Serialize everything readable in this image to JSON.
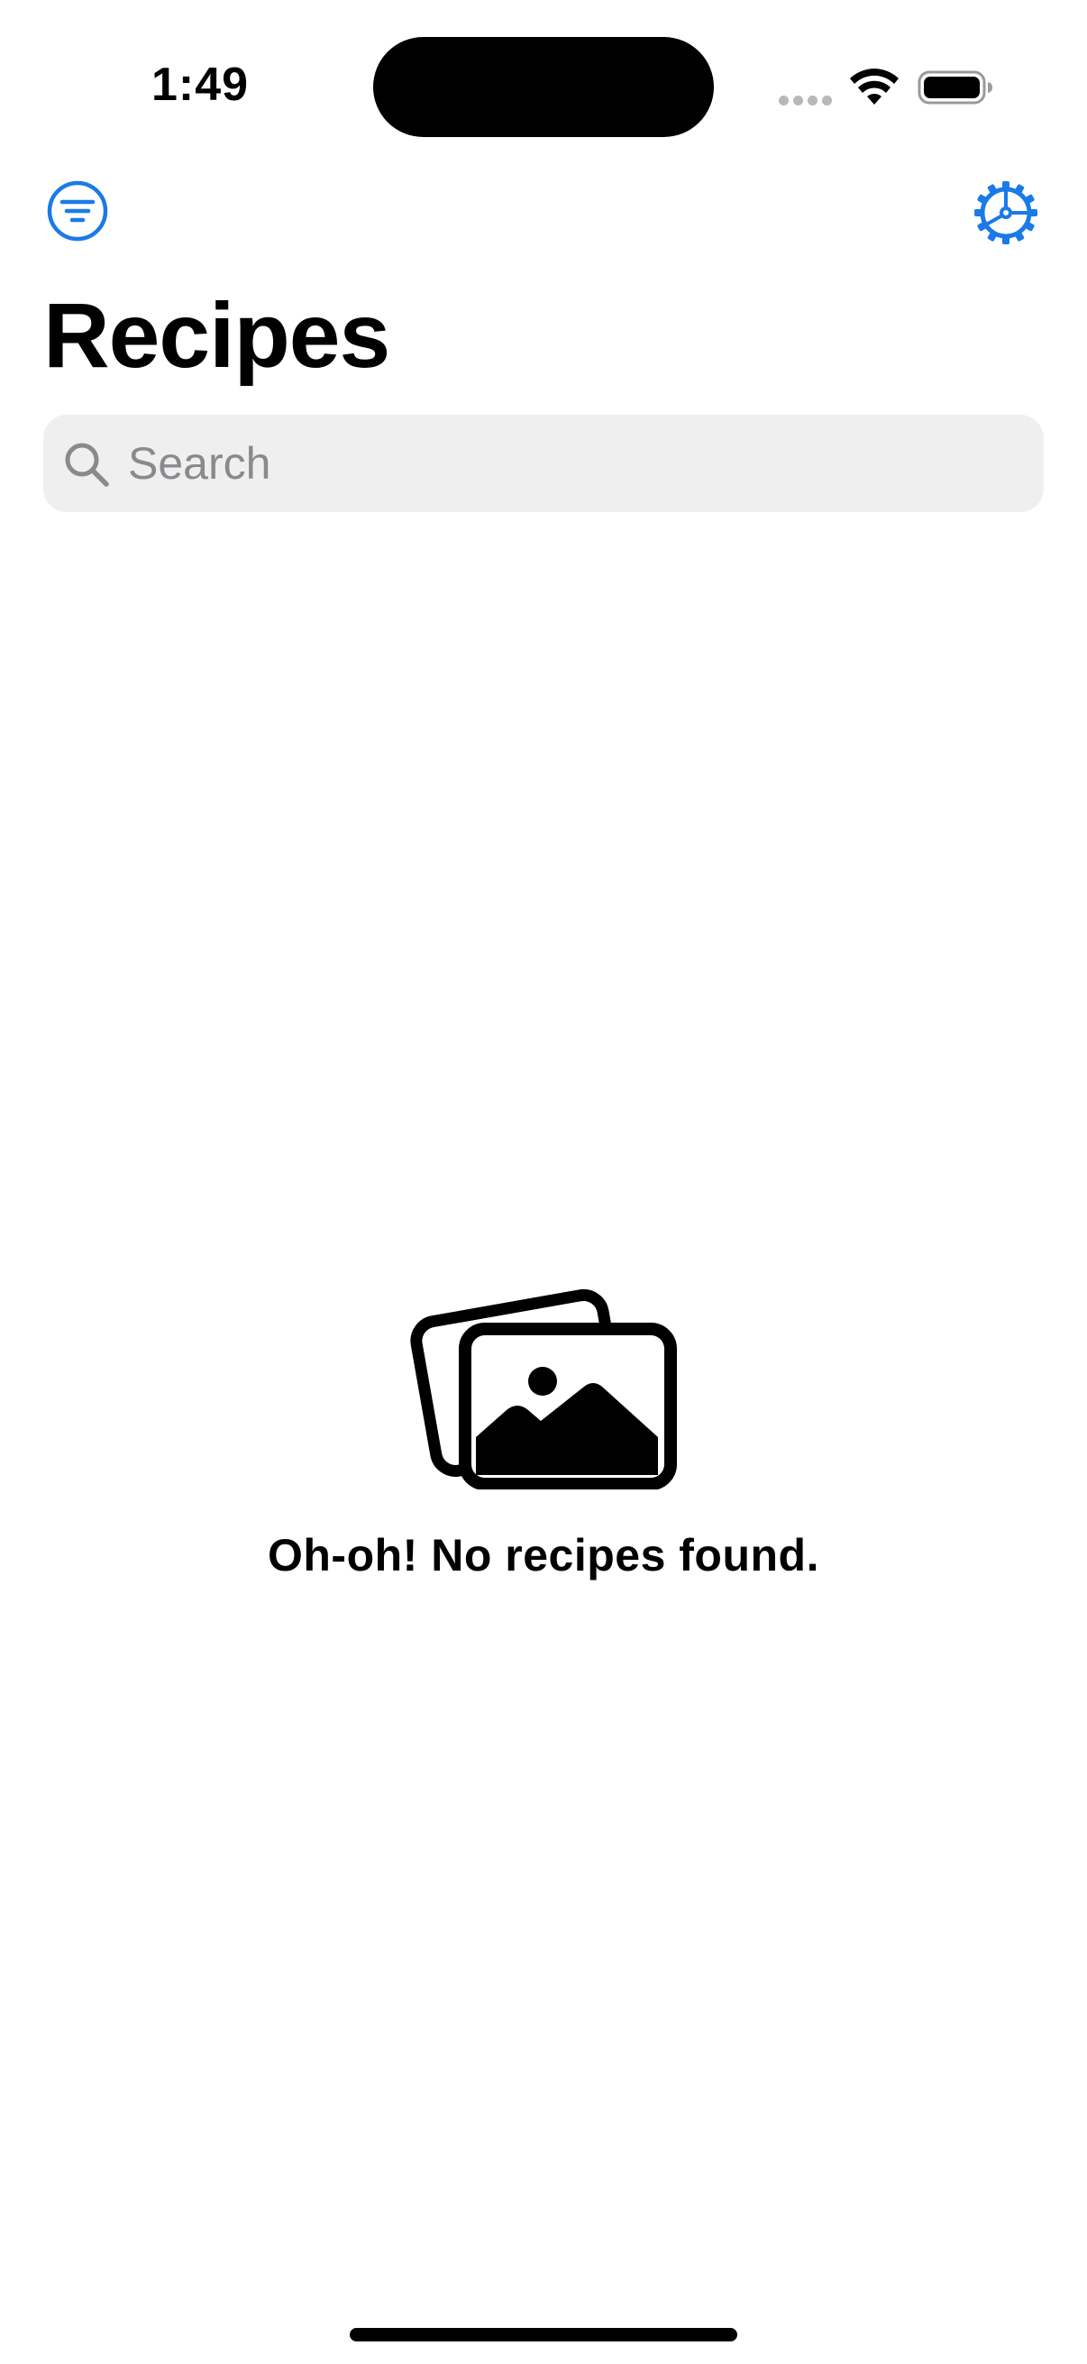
{
  "status_bar": {
    "time": "1:49"
  },
  "nav": {
    "title": "Recipes",
    "filter_icon": "line-3-horizontal-decrease-circle-icon",
    "settings_icon": "gear-icon"
  },
  "search": {
    "placeholder": "Search",
    "value": ""
  },
  "empty_state": {
    "icon": "photo-stack-icon",
    "message": "Oh-oh! No recipes found."
  },
  "colors": {
    "accent": "#1a7ae8",
    "search_background": "#efefef",
    "placeholder": "#8a8a8e"
  }
}
